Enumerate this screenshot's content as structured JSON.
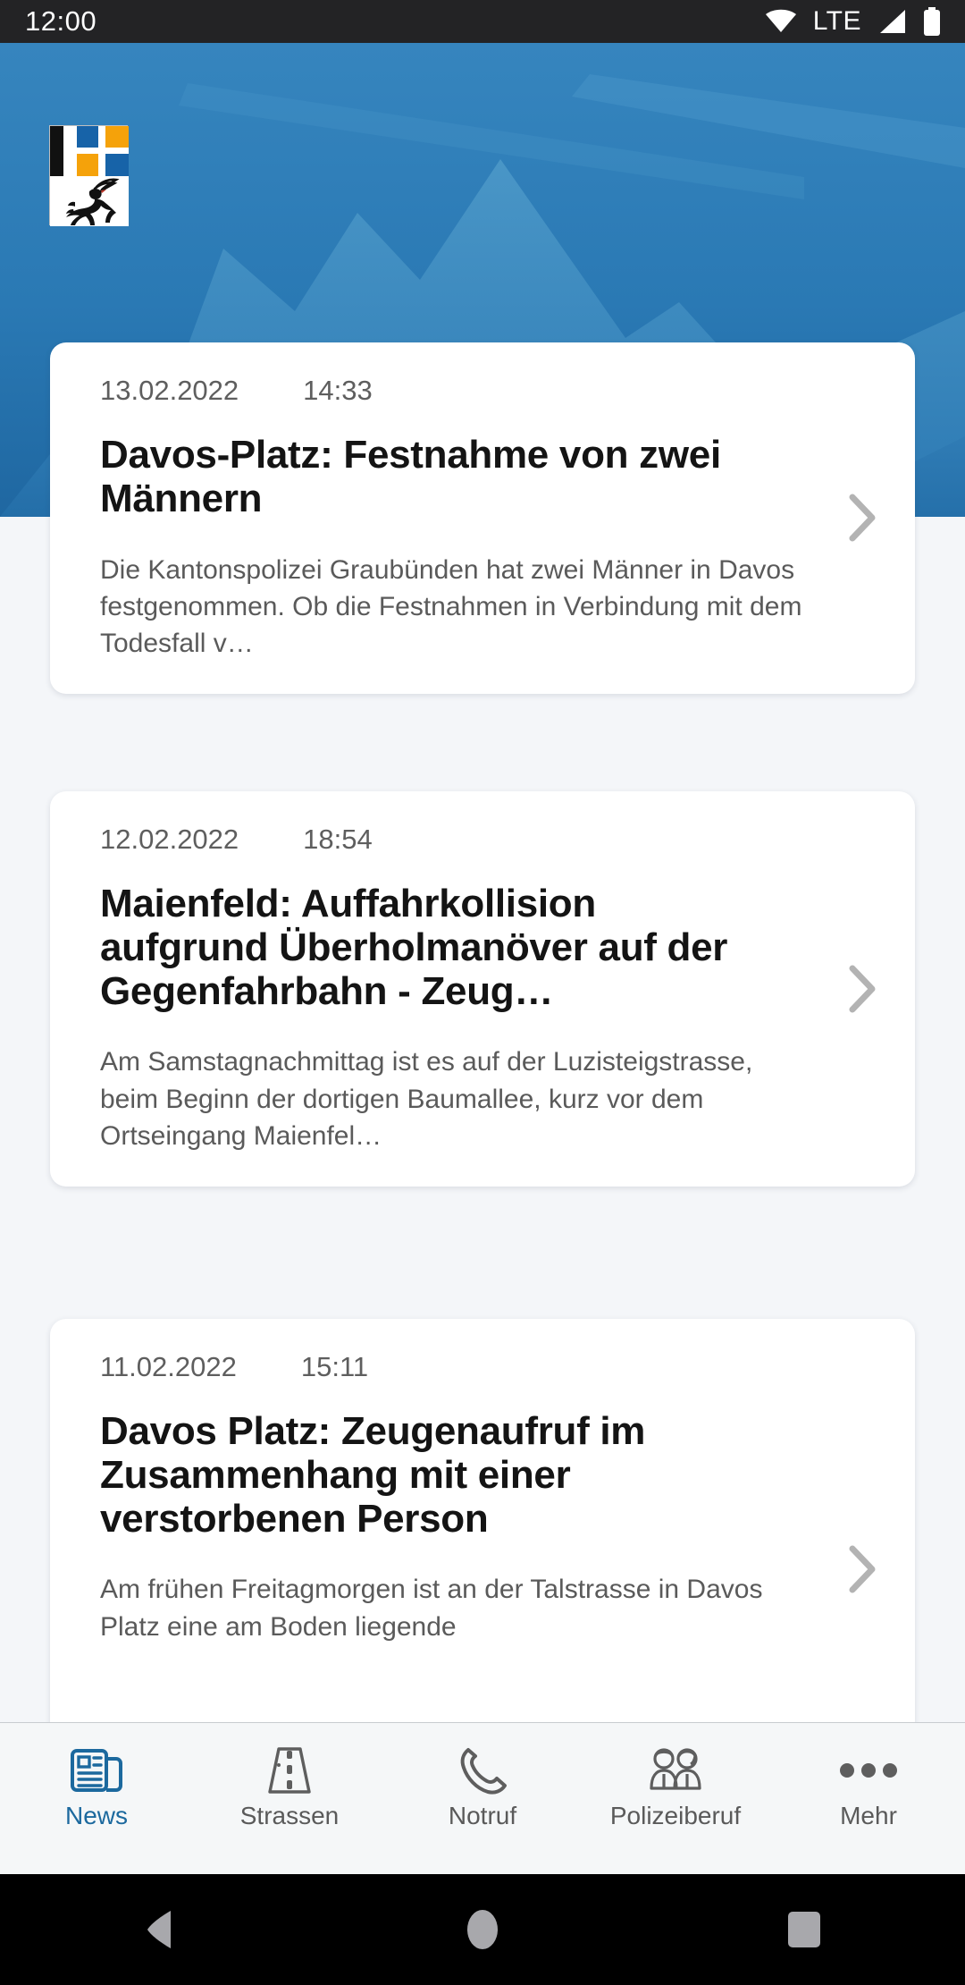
{
  "status_bar": {
    "time": "12:00",
    "network_label": "LTE",
    "icons": [
      "wifi-icon",
      "signal-icon",
      "battery-icon"
    ],
    "background_color": "#232325"
  },
  "header": {
    "crest_name": "graubuenden-coat-of-arms",
    "hero_image": "mountain-silhouette-blue",
    "hero_color": "#2271AC"
  },
  "theme": {
    "accent": "#1C699E",
    "page_background": "#F4F6F9",
    "card_background": "#FFFFFF",
    "muted_text": "#5A5A5A"
  },
  "news": {
    "items": [
      {
        "date": "13.02.2022",
        "time": "14:33",
        "title": "Davos-Platz: Festnahme von zwei Männern",
        "summary": "Die Kantonspolizei Graubünden hat zwei Männer in Davos festgenommen. Ob die Festnahmen in Verbindung mit dem Todesfall v…"
      },
      {
        "date": "12.02.2022",
        "time": "18:54",
        "title": "Maienfeld: Auffahrkollision aufgrund Überholmanöver auf der Gegenfahrbahn - Zeug…",
        "summary": "Am Samstagnachmittag ist es auf der Luzisteigstrasse, beim Beginn der dortigen Baumallee, kurz vor dem Ortseingang Maienfel…"
      },
      {
        "date": "11.02.2022",
        "time": "15:11",
        "title": "Davos Platz: Zeugenaufruf im Zusammenhang mit einer verstorbenen Person",
        "summary": "Am frühen Freitagmorgen ist an der Talstrasse in Davos Platz eine am Boden liegende"
      }
    ]
  },
  "bottom_nav": {
    "items": [
      {
        "label": "News",
        "icon": "newspaper-icon",
        "active": true
      },
      {
        "label": "Strassen",
        "icon": "road-icon",
        "active": false
      },
      {
        "label": "Notruf",
        "icon": "phone-icon",
        "active": false
      },
      {
        "label": "Polizeiberuf",
        "icon": "two-people-icon",
        "active": false
      },
      {
        "label": "Mehr",
        "icon": "three-dots-icon",
        "active": false
      }
    ]
  },
  "android_nav": {
    "buttons": [
      "back-button",
      "home-button",
      "recents-button"
    ]
  }
}
